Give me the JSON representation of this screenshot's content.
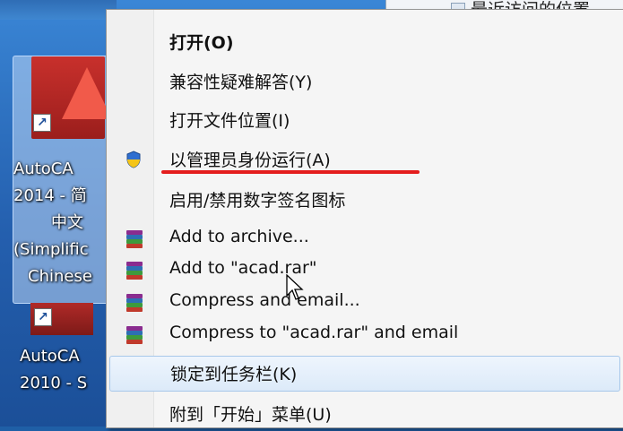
{
  "desktop": {
    "explorer_fragment": "最近访问的位置",
    "icons": [
      {
        "label_lines": [
          "AutoCA",
          "2014 - 简",
          "中文",
          "(Simplific",
          "Chinese"
        ]
      },
      {
        "label_lines": [
          "AutoCA",
          "2010 - S"
        ]
      }
    ]
  },
  "menu": {
    "items": [
      {
        "label": "打开(O)",
        "bold": true,
        "icon": ""
      },
      {
        "label": "兼容性疑难解答(Y)",
        "icon": ""
      },
      {
        "label": "打开文件位置(I)",
        "icon": ""
      },
      {
        "label": "以管理员身份运行(A)",
        "icon": "uac-shield-icon"
      },
      {
        "label": "启用/禁用数字签名图标",
        "icon": ""
      },
      {
        "label": "Add to archive...",
        "icon": "winrar-icon"
      },
      {
        "label": "Add to \"acad.rar\"",
        "icon": "winrar-icon"
      },
      {
        "label": "Compress and email...",
        "icon": "winrar-icon"
      },
      {
        "label": "Compress to \"acad.rar\" and email",
        "icon": "winrar-icon"
      },
      {
        "label": "锁定到任务栏(K)",
        "icon": "",
        "highlighted": true
      },
      {
        "label": "附到「开始」菜单(U)",
        "icon": ""
      }
    ]
  },
  "colors": {
    "annotation_underline": "#e41d1d",
    "menu_background": "#f5f5f5",
    "highlight_border": "#a8c8ea"
  }
}
